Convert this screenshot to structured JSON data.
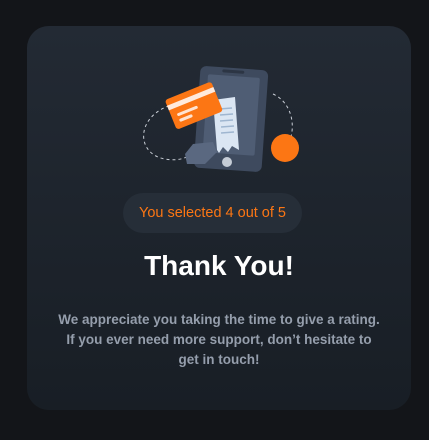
{
  "colors": {
    "page_background": "#131519",
    "card_background": "#1e252e",
    "accent": "#fc7614",
    "title": "#ffffff",
    "body_text": "#959eac"
  },
  "illustration": {
    "icons": [
      "phone-icon",
      "credit-card-icon",
      "receipt-icon"
    ]
  },
  "rating": {
    "selected_text": "You selected 4 out of 5",
    "selected": 4,
    "max": 5
  },
  "title": "Thank You!",
  "message": "We appreciate you taking the time to give a rating. If you ever need more support, don’t hesitate to get in touch!"
}
